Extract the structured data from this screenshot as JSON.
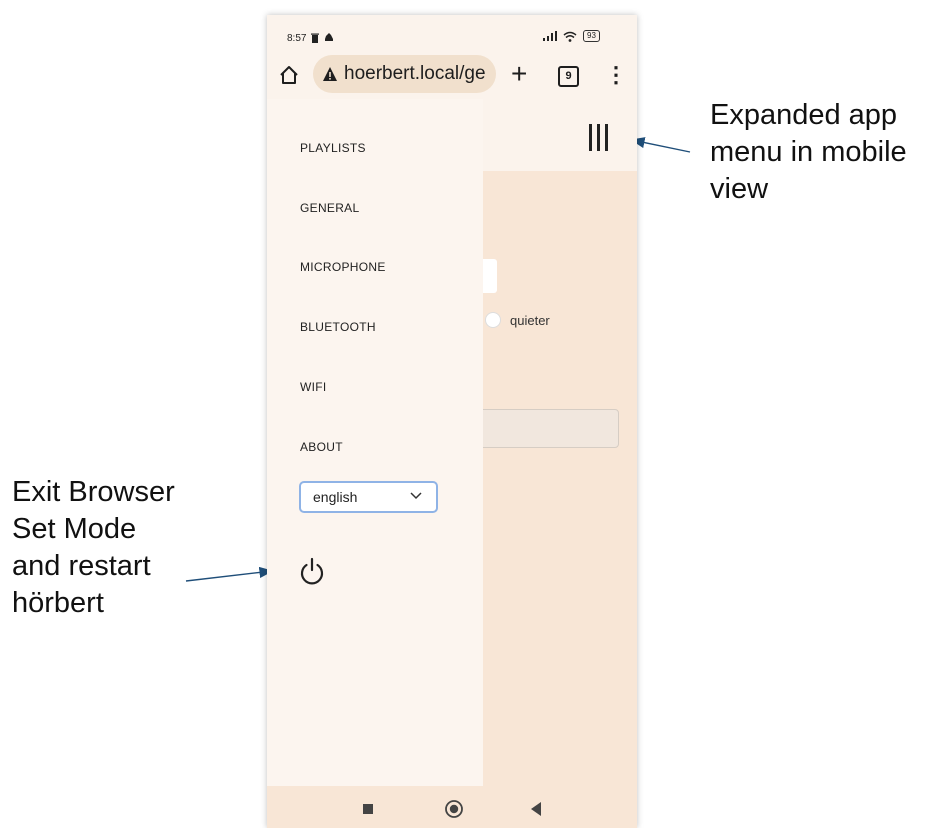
{
  "annotations": {
    "menu_note": "Expanded app menu in mobile view",
    "exit_note": "Exit Browser Set Mode and restart hörbert"
  },
  "status_bar": {
    "time": "8:57",
    "left_icons": [
      "trash-icon",
      "cloud-icon"
    ],
    "right_icons": [
      "signal-icon",
      "wifi-icon"
    ],
    "battery": "93"
  },
  "browser": {
    "url": "hoerbert.local/ge",
    "tab_count": "9",
    "icons": [
      "home-icon",
      "warning-icon",
      "plus-icon",
      "tabs-icon",
      "more-icon"
    ]
  },
  "app": {
    "menu_button_icon": "hamburger-icon",
    "menu": [
      {
        "label": "PLAYLISTS"
      },
      {
        "label": "GENERAL"
      },
      {
        "label": "MICROPHONE"
      },
      {
        "label": "BLUETOOTH"
      },
      {
        "label": "WIFI"
      },
      {
        "label": "ABOUT"
      }
    ],
    "language": {
      "selected": "english"
    },
    "power_icon": "power-icon",
    "content": {
      "radio_label": "quieter"
    }
  },
  "navbar": {
    "icons": [
      "recents-icon",
      "home-icon",
      "back-icon"
    ]
  },
  "colors": {
    "app_background": "#f8e6d6",
    "drawer_background": "#fcf5ef",
    "arrow": "#1f4e79",
    "select_border": "#8fb3e6"
  }
}
